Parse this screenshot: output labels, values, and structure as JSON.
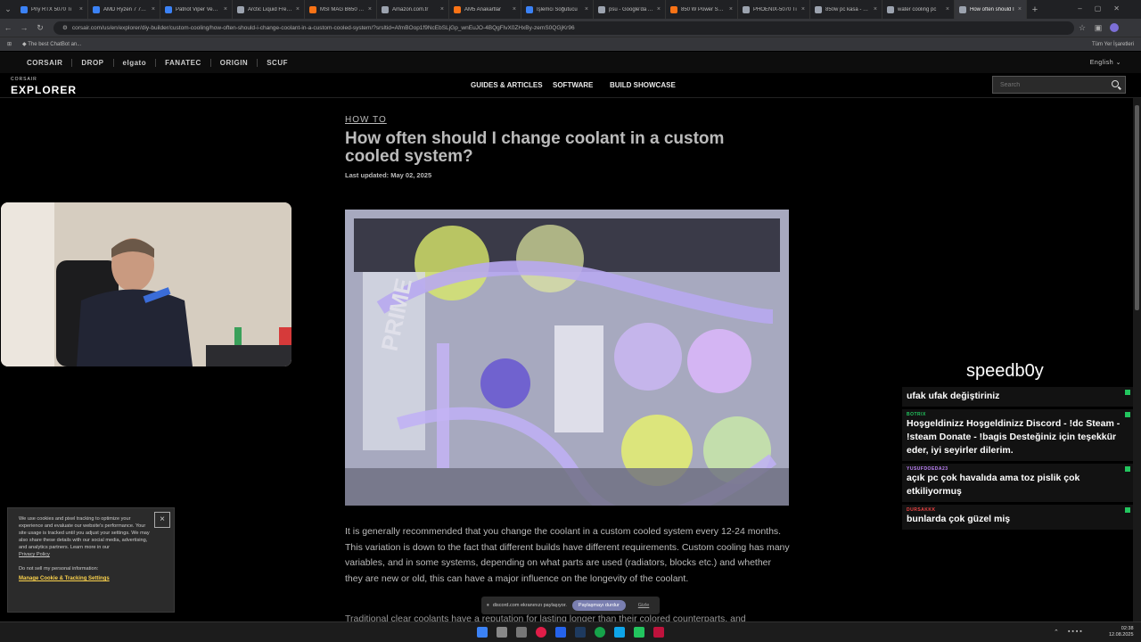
{
  "browser": {
    "tabs": [
      {
        "label": "Pny RTX 5070 Ti",
        "color": "#3b82f6"
      },
      {
        "label": "AMD Ryzen 7 7800X3D",
        "color": "#3b82f6"
      },
      {
        "label": "Patriot Viper Venom",
        "color": "#3b82f6"
      },
      {
        "label": "Arctic Liquid Freezer",
        "color": "#9ca3af"
      },
      {
        "label": "MSI MAG B650 Tomahawk",
        "color": "#f97316"
      },
      {
        "label": "Amazon.com.tr",
        "color": "#9ca3af"
      },
      {
        "label": "AM5 Anakartlar",
        "color": "#f97316"
      },
      {
        "label": "İşlemci Soğutucu",
        "color": "#3b82f6"
      },
      {
        "label": "psu - Google'da Ara",
        "color": "#9ca3af"
      },
      {
        "label": "850 W Power Supply",
        "color": "#f97316"
      },
      {
        "label": "PHOENIX-5070 Ti",
        "color": "#9ca3af"
      },
      {
        "label": "850w pc kasa - Google",
        "color": "#9ca3af"
      },
      {
        "label": "water cooling pc",
        "color": "#9ca3af"
      },
      {
        "label": "How often should I",
        "color": "#9ca3af",
        "active": true
      }
    ],
    "url": "corsair.com/us/en/explorer/diy-builder/custom-cooling/how-often-should-i-change-coolant-in-a-custom-cooled-system/?srsltid=AfmBOop1f9NcEbSLjGp_wnEuJO-4BQgFlvX0ZHxBy-zemS0QGjKr96",
    "bookmark": "The best ChatBot an...",
    "all_bookmarks": "Tüm Yer İşaretleri"
  },
  "site": {
    "brands": [
      "CORSAIR",
      "DROP",
      "elgato",
      "FANATEC",
      "ORIGIN",
      "SCUF"
    ],
    "language": "English",
    "logo_small": "CORSAIR",
    "logo_big": "EXPLORER",
    "nav": [
      "GUIDES & ARTICLES",
      "SOFTWARE",
      "BUILD SHOWCASE"
    ],
    "search_placeholder": "Search"
  },
  "article": {
    "kicker": "HOW TO",
    "title": "How often should I change coolant in a custom cooled system?",
    "updated": "Last updated: May 02, 2025",
    "hero_text": "PRIME",
    "para1": "It is generally recommended that you change the coolant in a custom cooled system every 12-24 months. This variation is down to the fact that different builds have different requirements. Custom cooling has many variables, and in some systems, depending on what parts are used (radiators, blocks etc.) and whether they are new or old, this can have a major influence on the longevity of the coolant.",
    "para2": "Traditional clear coolants have a reputation for lasting longer than their colored counterparts, and"
  },
  "stream": {
    "streamer": "speedb0y",
    "messages": [
      {
        "user": "",
        "text": "ufak ufak değiştiriniz",
        "color": "#22c55e"
      },
      {
        "user": "BOTRIX",
        "text": "Hoşgeldinizz Hoşgeldinizz Discord - !dc Steam - !steam Donate - !bagis Desteğiniz için teşekkür eder, iyi seyirler dilerim.",
        "color": "#22c55e"
      },
      {
        "user": "YUSUFDOEDA23",
        "text": "açık pc çok havalıda ama toz pislik çok etkiliyormuş",
        "color": "#c084fc"
      },
      {
        "user": "DURSAKKK",
        "text": "bunlarda çok güzel miş",
        "color": "#ef4444"
      }
    ]
  },
  "cookie": {
    "text": "We use cookies and pixel tracking to optimize your experience and evaluate our website's performance. Your site usage is tracked until you adjust your settings. We may also share these details with our social media, advertising, and analytics partners. Learn more in our",
    "privacy": "Privacy Policy",
    "dns": "Do not sell my personal information:",
    "manage": "Manage Cookie & Tracking Settings",
    "close": "×"
  },
  "share": {
    "text": "discord.com ekranınızı paylaşıyor.",
    "stop": "Paylaşmayı durdur",
    "hide": "Gizle"
  },
  "taskbar": {
    "time": "02:38",
    "date": "12.08.2025"
  }
}
